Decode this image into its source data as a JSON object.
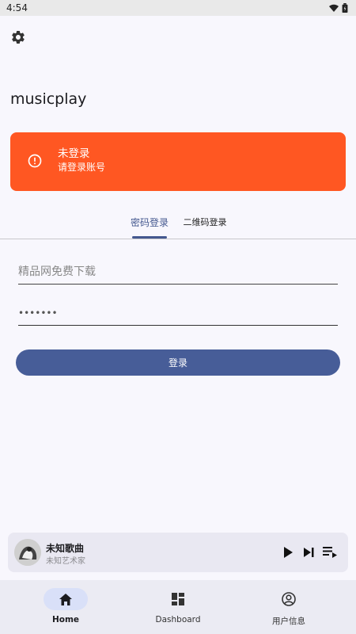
{
  "status_bar": {
    "time": "4:54"
  },
  "app": {
    "title": "musicplay"
  },
  "alert": {
    "title": "未登录",
    "subtitle": "请登录账号",
    "color": "#ff5722"
  },
  "tabs": [
    {
      "label": "密码登录",
      "active": true
    },
    {
      "label": "二维码登录",
      "active": false
    }
  ],
  "form": {
    "username_placeholder": "精品网免费下载",
    "password_value": "•••••••",
    "login_label": "登录"
  },
  "player": {
    "song_title": "未知歌曲",
    "artist": "未知艺术家"
  },
  "nav": [
    {
      "label": "Home",
      "icon": "home-icon",
      "active": true
    },
    {
      "label": "Dashboard",
      "icon": "dashboard-icon",
      "active": false
    },
    {
      "label": "用户信息",
      "icon": "account-circle-icon",
      "active": false
    }
  ],
  "colors": {
    "accent": "#475d98",
    "background": "#f8f7fd",
    "alert": "#ff5722"
  }
}
